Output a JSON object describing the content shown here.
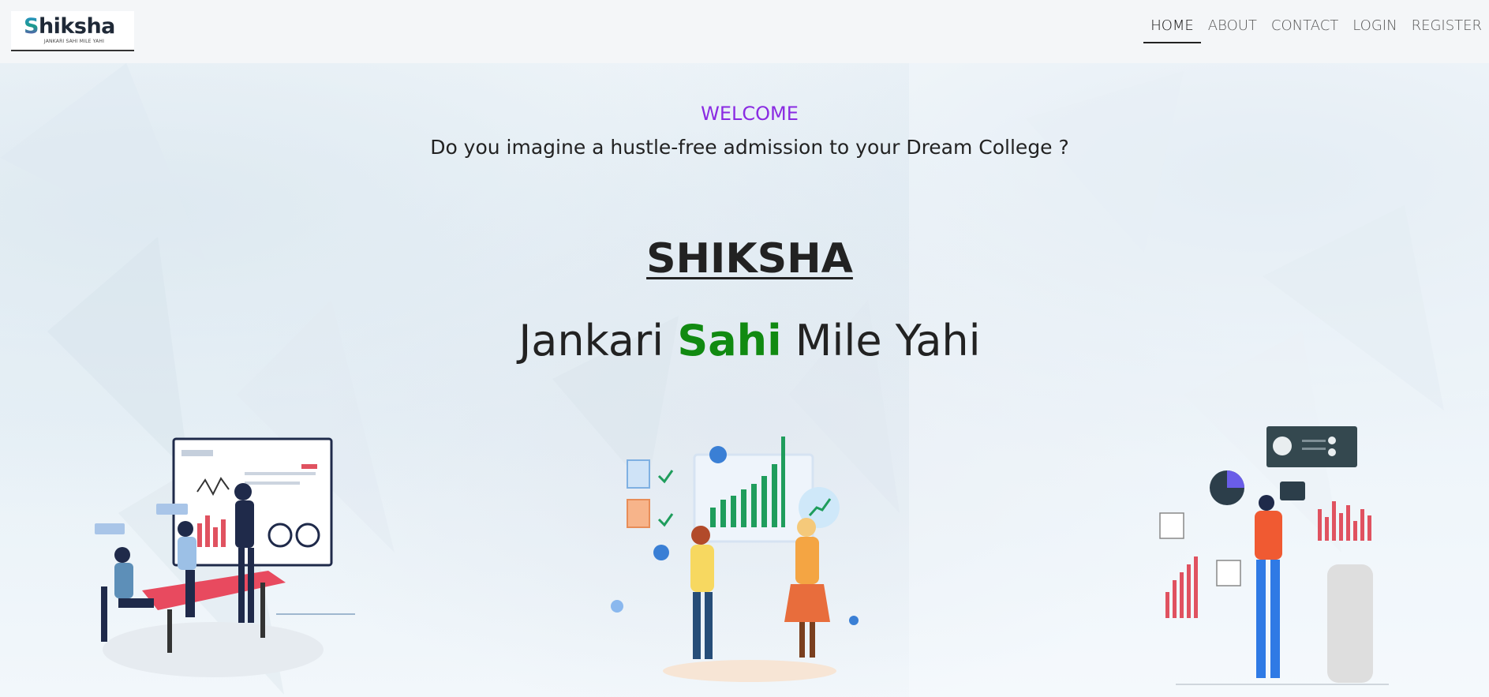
{
  "logo": {
    "brand_first": "S",
    "brand_rest": "hiksha",
    "tagline": "JANKARI SAHI MILE YAHI"
  },
  "nav": [
    {
      "label": "HOME",
      "active": true
    },
    {
      "label": "ABOUT",
      "active": false
    },
    {
      "label": "CONTACT",
      "active": false
    },
    {
      "label": "LOGIN",
      "active": false
    },
    {
      "label": "REGISTER",
      "active": false
    }
  ],
  "hero": {
    "welcome": "WELCOME",
    "question": "Do you imagine a hustle-free admission to your Dream College ?",
    "brand": "SHIKSHA",
    "motto_part1": "Jankari ",
    "motto_highlight": "Sahi",
    "motto_part2": " Mile Yahi"
  },
  "colors": {
    "welcome": "#8a2be2",
    "highlight": "#118a11",
    "text": "#222222"
  },
  "illustrations": [
    {
      "name": "team-meeting-illustration"
    },
    {
      "name": "high-five-growth-illustration"
    },
    {
      "name": "analyst-charts-illustration"
    }
  ]
}
